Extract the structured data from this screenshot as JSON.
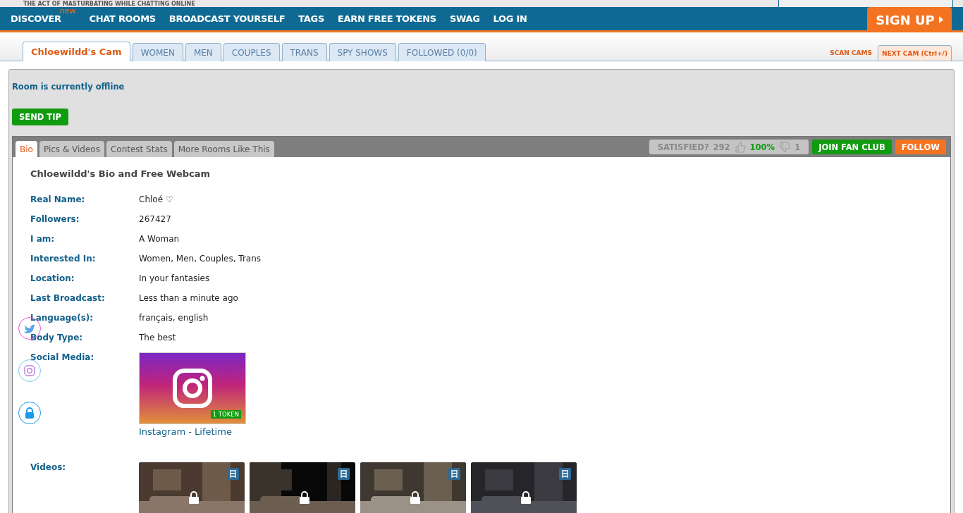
{
  "tagline": "THE ACT OF MASTURBATING WHILE CHATTING ONLINE",
  "nav": {
    "items": [
      {
        "label": "DISCOVER",
        "badge": "new"
      },
      {
        "label": "CHAT ROOMS"
      },
      {
        "label": "BROADCAST YOURSELF"
      },
      {
        "label": "TAGS"
      },
      {
        "label": "EARN FREE TOKENS"
      },
      {
        "label": "SWAG"
      },
      {
        "label": "LOG IN"
      }
    ],
    "signup": "SIGN UP"
  },
  "tabs": [
    {
      "label": "Chloewildd's Cam",
      "selected": true
    },
    {
      "label": "WOMEN",
      "selected": false
    },
    {
      "label": "MEN",
      "selected": false
    },
    {
      "label": "COUPLES",
      "selected": false
    },
    {
      "label": "TRANS",
      "selected": false
    },
    {
      "label": "SPY SHOWS",
      "selected": false
    },
    {
      "label": "FOLLOWED (0/0)",
      "selected": false
    }
  ],
  "scan_cams": "SCAN CAMS",
  "next_cam": "NEXT CAM (Ctrl+/)",
  "room_status": "Room is currently offline",
  "send_tip": "SEND TIP",
  "info_tabs": [
    {
      "label": "Bio",
      "selected": true
    },
    {
      "label": "Pics & Videos",
      "selected": false
    },
    {
      "label": "Contest Stats",
      "selected": false
    },
    {
      "label": "More Rooms Like This",
      "selected": false
    }
  ],
  "satisfaction": {
    "label": "SATISFIED?",
    "count": "292",
    "percent": "100%",
    "down": "1"
  },
  "join_fan_club": "JOIN FAN CLUB",
  "follow": "FOLLOW",
  "bio": {
    "title": "Chloewildd's Bio and Free Webcam",
    "fields": [
      {
        "label": "Real Name:",
        "value": "Chloé ♡"
      },
      {
        "label": "Followers:",
        "value": "267427"
      },
      {
        "label": "I am:",
        "value": "A Woman"
      },
      {
        "label": "Interested In:",
        "value": "Women, Men, Couples, Trans"
      },
      {
        "label": "Location:",
        "value": "In your fantasies"
      },
      {
        "label": "Last Broadcast:",
        "value": "Less than a minute ago"
      },
      {
        "label": "Language(s):",
        "value": "français, english"
      },
      {
        "label": "Body Type:",
        "value": "The best"
      }
    ],
    "social_label": "Social Media:",
    "social": {
      "price": "1 TOKEN",
      "link": "Instagram - Lifetime"
    },
    "videos_label": "Videos:"
  }
}
